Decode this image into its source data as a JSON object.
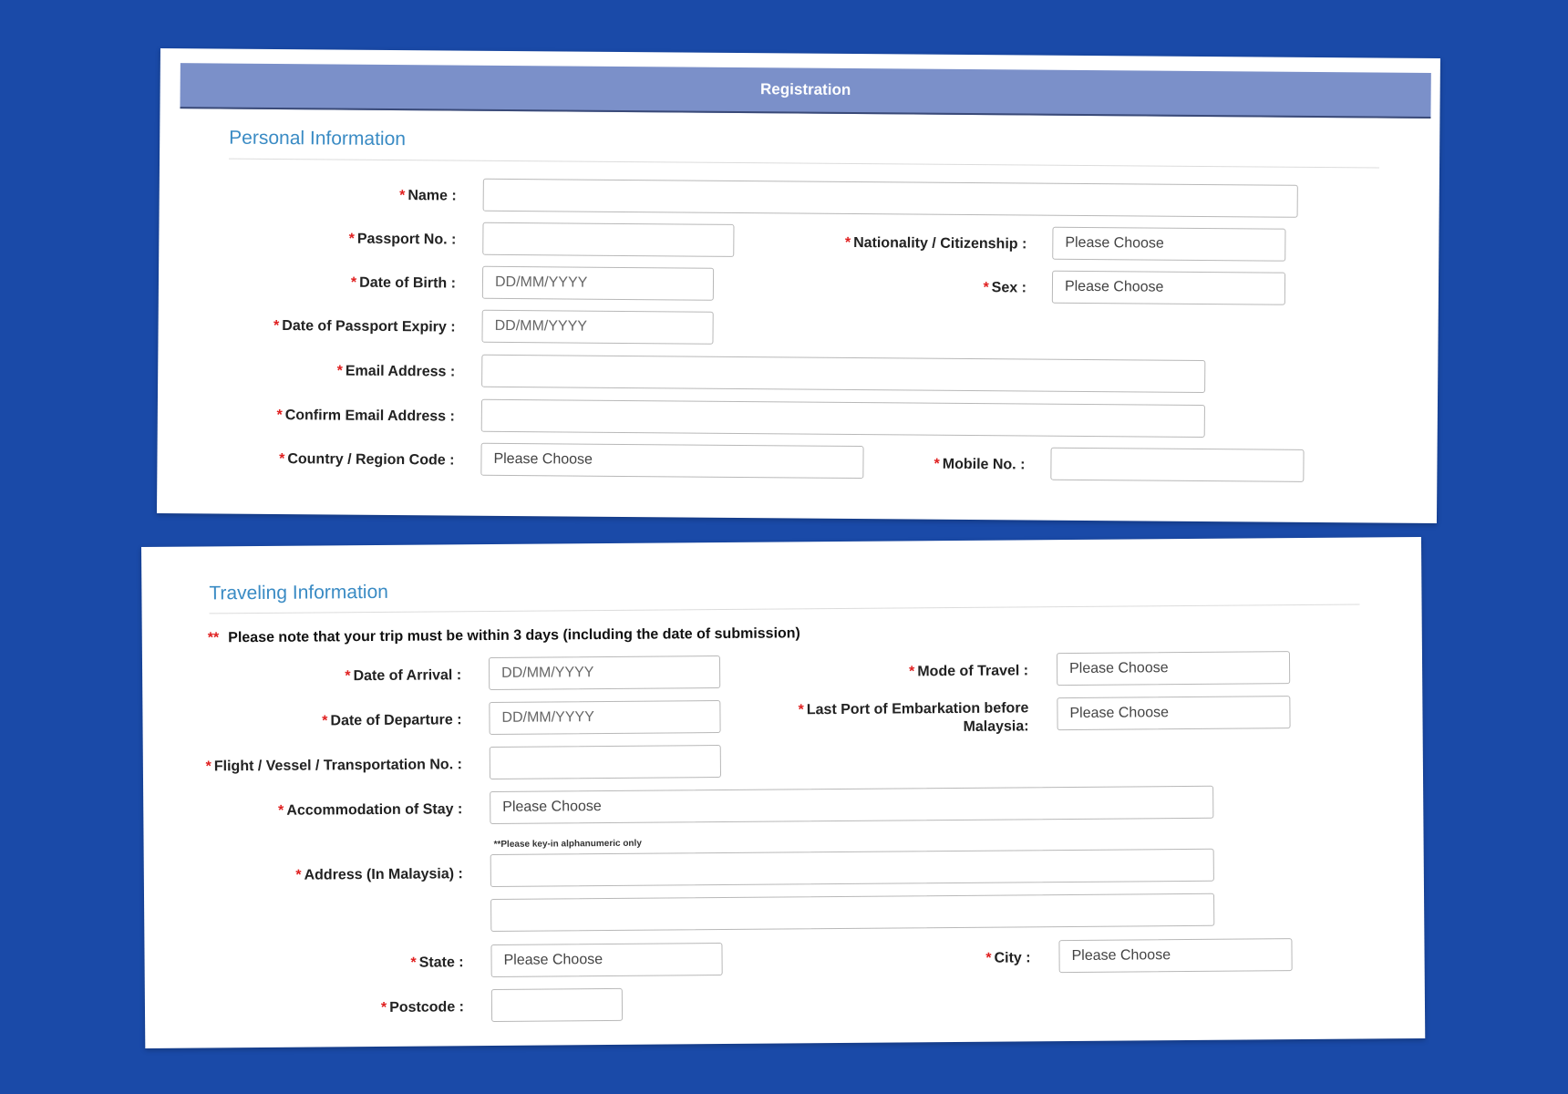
{
  "header": {
    "title": "Registration"
  },
  "personal": {
    "title": "Personal Information",
    "name": {
      "label": "Name :",
      "value": ""
    },
    "passport_no": {
      "label": "Passport No. :",
      "value": ""
    },
    "nationality": {
      "label": "Nationality / Citizenship :",
      "value": "Please Choose"
    },
    "dob": {
      "label": "Date of Birth :",
      "placeholder": "DD/MM/YYYY"
    },
    "sex": {
      "label": "Sex :",
      "value": "Please Choose"
    },
    "passport_expiry": {
      "label": "Date of Passport Expiry :",
      "placeholder": "DD/MM/YYYY"
    },
    "email": {
      "label": "Email Address :",
      "value": ""
    },
    "confirm_email": {
      "label": "Confirm Email Address :",
      "value": ""
    },
    "country_code": {
      "label": "Country / Region Code :",
      "value": "Please Choose"
    },
    "mobile": {
      "label": "Mobile No. :",
      "value": ""
    }
  },
  "traveling": {
    "title": "Traveling Information",
    "note_marker": "**",
    "note": "Please note that your trip must be within 3 days (including the date of submission)",
    "arrival": {
      "label": "Date of Arrival :",
      "placeholder": "DD/MM/YYYY"
    },
    "mode": {
      "label": "Mode of Travel :",
      "value": "Please Choose"
    },
    "departure": {
      "label": "Date of Departure :",
      "placeholder": "DD/MM/YYYY"
    },
    "last_port": {
      "label": "Last Port of Embarkation before Malaysia:",
      "value": "Please Choose"
    },
    "flight": {
      "label": "Flight / Vessel / Transportation No. :",
      "value": ""
    },
    "accommodation": {
      "label": "Accommodation of Stay :",
      "value": "Please Choose"
    },
    "address_hint": "**Please key-in alphanumeric only",
    "address": {
      "label": "Address (In Malaysia) :",
      "line1": "",
      "line2": ""
    },
    "state": {
      "label": "State :",
      "value": "Please Choose"
    },
    "city": {
      "label": "City :",
      "value": "Please Choose"
    },
    "postcode": {
      "label": "Postcode :",
      "value": ""
    }
  },
  "required_marker": "*",
  "colors": {
    "background": "#1a4aa8",
    "header": "#7b90c9",
    "section_title": "#3a8bc4",
    "required": "#e02020"
  }
}
